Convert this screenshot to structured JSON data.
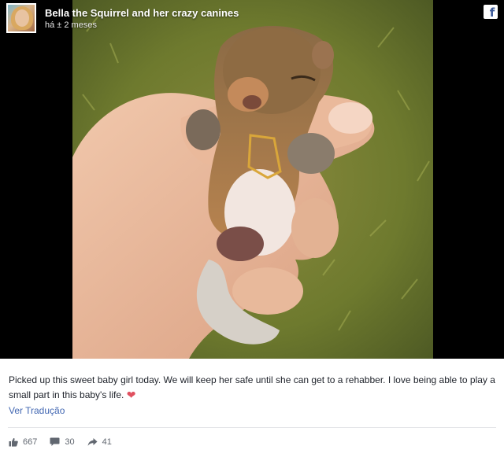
{
  "header": {
    "page_name": "Bella the Squirrel and her crazy canines",
    "timestamp": "há ± 2 meses",
    "avatar_icon": "profile-photo",
    "network_icon": "facebook-f-icon"
  },
  "media": {
    "image_subject": "photo"
  },
  "post": {
    "text": "Picked up this sweet baby girl today. We will keep her safe until she can get to a rehabber. I love being able to play a small part in this baby's life.",
    "emoji": "❤",
    "translate_label": "Ver Tradução"
  },
  "stats": {
    "likes": "667",
    "comments": "30",
    "shares": "41"
  },
  "colors": {
    "link": "#4267b2",
    "heart": "#e0505f",
    "meta_text": "#616770"
  }
}
